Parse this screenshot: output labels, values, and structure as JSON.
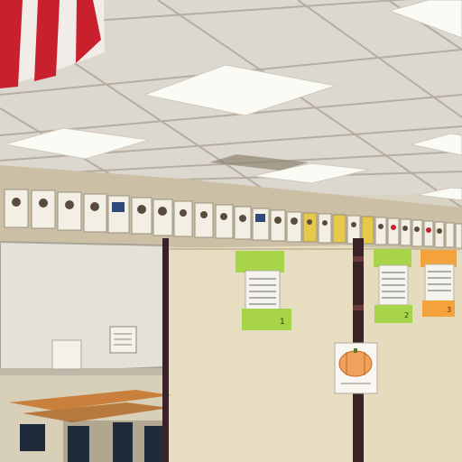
{
  "scene": {
    "description_colors": {
      "ceiling": "#ddd8cf",
      "ceiling_grid": "#b9b2a6",
      "light_panel": "#fbfbf6",
      "upper_wall": "#cdc2a8",
      "whiteboard": "#e4e2dc",
      "partition": "#e6dcc0",
      "pole": "#3a2326",
      "flag_red": "#c8202c",
      "flag_white": "#f1ece8",
      "sticky_green": "#a8d44a",
      "sticky_orange": "#f4a33c"
    }
  },
  "notes": [
    {
      "text": "1"
    },
    {
      "text": "2"
    },
    {
      "text": "3"
    }
  ]
}
